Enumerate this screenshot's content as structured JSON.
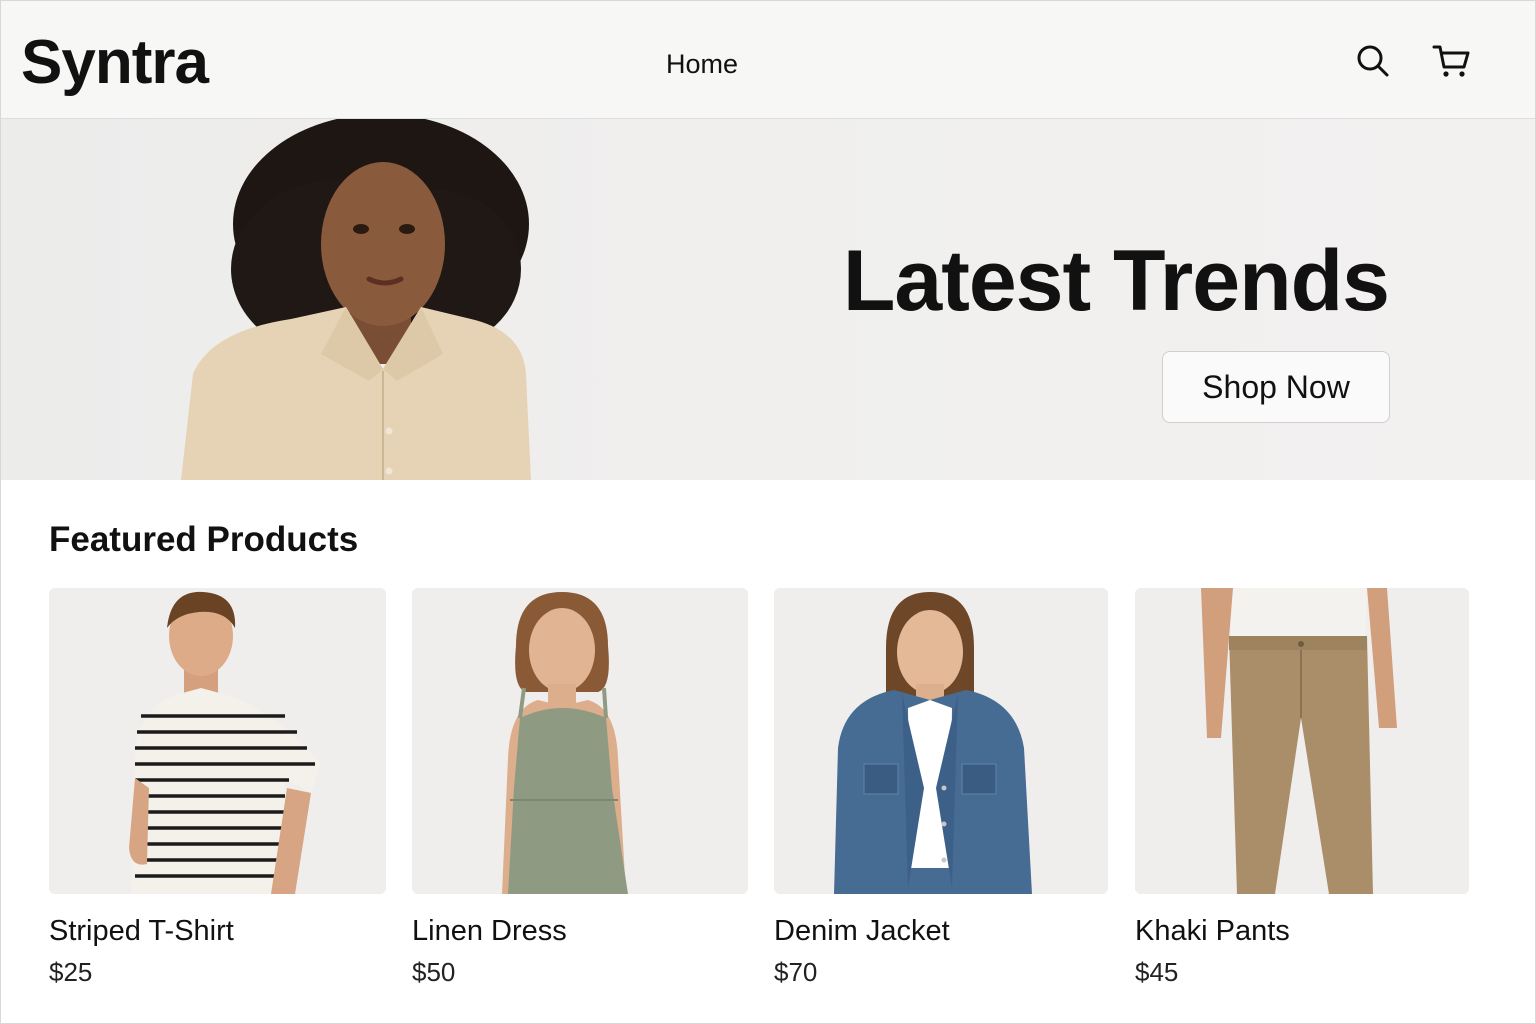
{
  "header": {
    "logo": "Syntra",
    "nav": {
      "home_label": "Home"
    },
    "icons": {
      "search": "search-icon",
      "cart": "cart-icon"
    }
  },
  "hero": {
    "title": "Latest Trends",
    "cta_label": "Shop Now"
  },
  "featured": {
    "title": "Featured Products",
    "products": [
      {
        "name": "Striped T-Shirt",
        "price": "$25"
      },
      {
        "name": "Linen Dress",
        "price": "$50"
      },
      {
        "name": "Denim Jacket",
        "price": "$70"
      },
      {
        "name": "Khaki Pants",
        "price": "$45"
      }
    ]
  },
  "colors": {
    "header_bg": "#f7f7f6",
    "hero_bg": "#efeeed",
    "text": "#111111"
  }
}
